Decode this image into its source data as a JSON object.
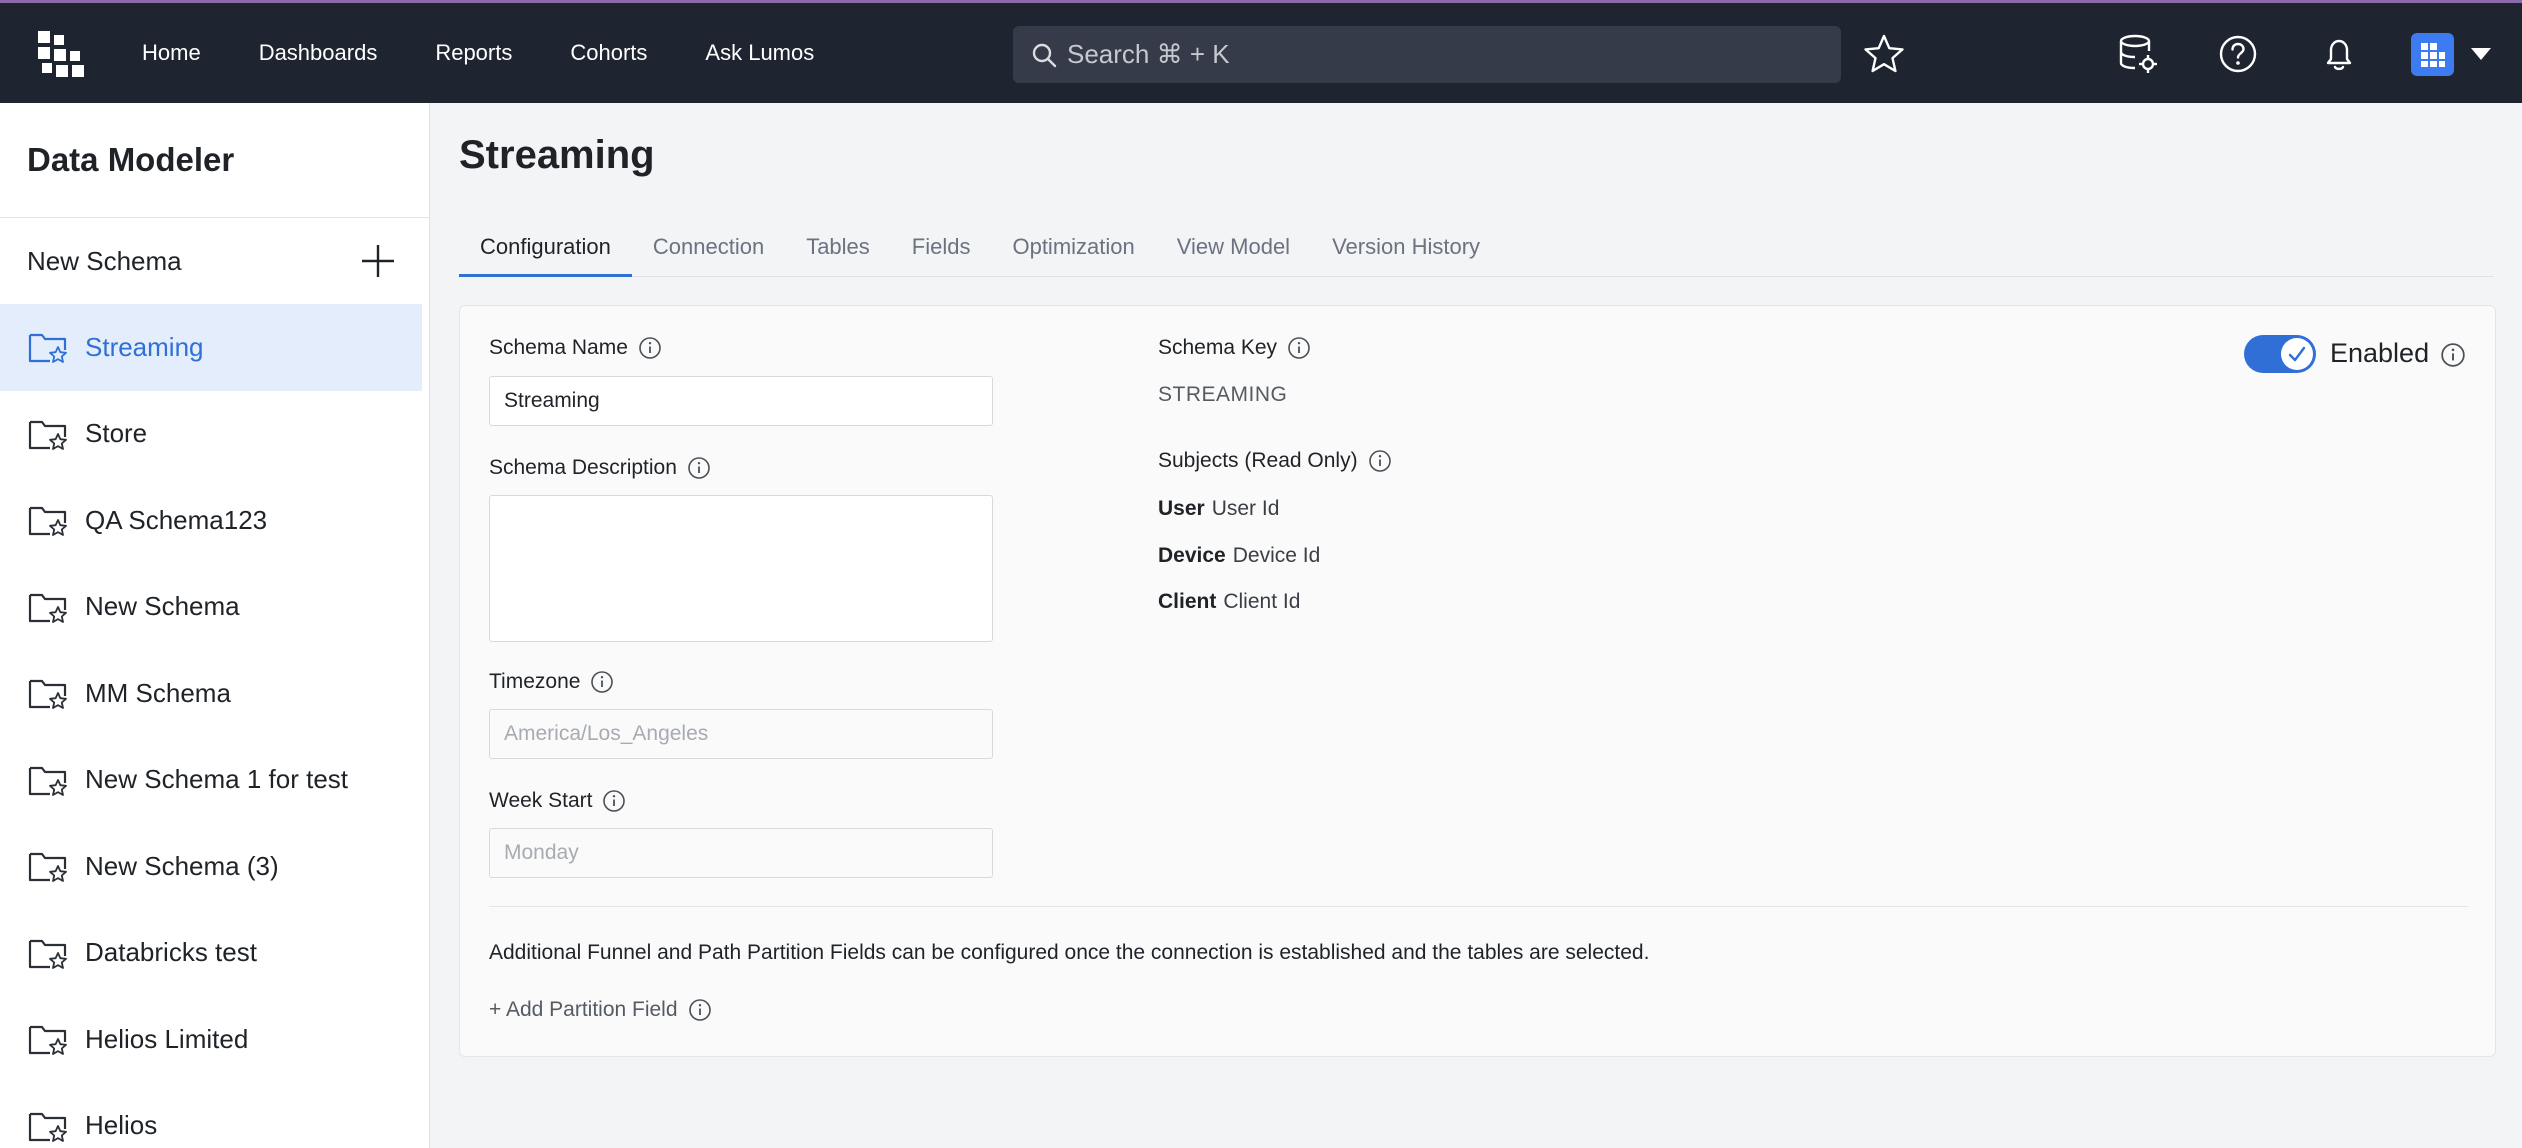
{
  "nav": {
    "links": [
      "Home",
      "Dashboards",
      "Reports",
      "Cohorts",
      "Ask Lumos"
    ],
    "search_placeholder": "Search ⌘ + K"
  },
  "sidebar": {
    "title": "Data Modeler",
    "new_schema_label": "New Schema",
    "items": [
      {
        "label": "Streaming",
        "active": true
      },
      {
        "label": "Store"
      },
      {
        "label": "QA Schema123"
      },
      {
        "label": "New Schema"
      },
      {
        "label": "MM Schema"
      },
      {
        "label": "New Schema 1 for test"
      },
      {
        "label": "New Schema (3)"
      },
      {
        "label": "Databricks test"
      },
      {
        "label": "Helios Limited"
      },
      {
        "label": "Helios"
      }
    ]
  },
  "main": {
    "title": "Streaming",
    "tabs": [
      "Configuration",
      "Connection",
      "Tables",
      "Fields",
      "Optimization",
      "View Model",
      "Version History"
    ],
    "active_tab": "Configuration",
    "form": {
      "schema_name_label": "Schema Name",
      "schema_name_value": "Streaming",
      "schema_description_label": "Schema Description",
      "schema_description_value": "",
      "timezone_label": "Timezone",
      "timezone_placeholder": "America/Los_Angeles",
      "week_start_label": "Week Start",
      "week_start_placeholder": "Monday",
      "schema_key_label": "Schema Key",
      "schema_key_value": "STREAMING",
      "subjects_label": "Subjects (Read Only)",
      "subjects": [
        {
          "name": "User",
          "value": "User Id"
        },
        {
          "name": "Device",
          "value": "Device Id"
        },
        {
          "name": "Client",
          "value": "Client Id"
        }
      ],
      "enabled_label": "Enabled",
      "enabled": true,
      "partition_note": "Additional Funnel and Path Partition Fields can be configured once the connection is established and the tables are selected.",
      "add_partition_label": "+ Add Partition Field"
    }
  },
  "colors": {
    "accent": "#2f6fd6",
    "topbar": "#1e2430",
    "active_item_bg": "#e4edfb"
  }
}
